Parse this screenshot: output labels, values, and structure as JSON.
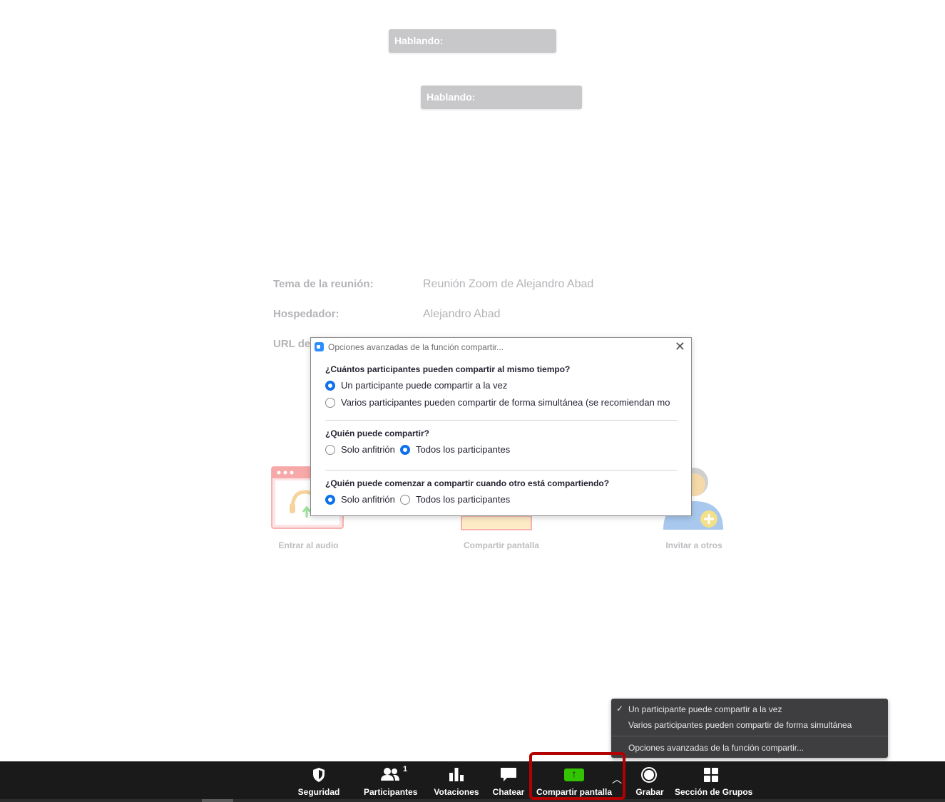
{
  "speaking_labels": [
    "Hablando:",
    "Hablando:"
  ],
  "meeting_info": {
    "topic_label": "Tema de la reunión:",
    "topic_value": "Reunión Zoom de Alejandro Abad",
    "host_label": "Hospedador:",
    "host_value": "Alejandro Abad",
    "url_label": "URL de"
  },
  "tiles": {
    "audio": "Entrar al audio",
    "share": "Compartir pantalla",
    "invite": "Invitar a otros"
  },
  "dialog": {
    "title": "Opciones avanzadas de la función compartir...",
    "q1": "¿Cuántos participantes pueden compartir al mismo tiempo?",
    "q1_opt1": "Un participante puede compartir a la vez",
    "q1_opt2": "Varios participantes pueden compartir de forma simultánea (se recomiendan mo",
    "q1_selected": 1,
    "q2": "¿Quién puede compartir?",
    "q2_opt1": "Solo anfitrión",
    "q2_opt2": "Todos los participantes",
    "q2_selected": 2,
    "q3": "¿Quién puede comenzar a compartir cuando otro está compartiendo?",
    "q3_opt1": "Solo anfitrión",
    "q3_opt2": "Todos los participantes",
    "q3_selected": 1
  },
  "menu": {
    "item1": "Un participante puede compartir a la vez",
    "item2": "Varios participantes pueden compartir de forma simultánea",
    "item3": "Opciones avanzadas de la función compartir...",
    "checked_item": 1
  },
  "toolbar": {
    "security": "Seguridad",
    "participants": "Participantes",
    "participants_count": "1",
    "polls": "Votaciones",
    "chat": "Chatear",
    "share": "Compartir pantalla",
    "record": "Grabar",
    "breakout": "Sección de Grupos"
  },
  "colors": {
    "accent": "#0e71eb",
    "share_green": "#33c300",
    "highlight": "#b30000",
    "toolbar_bg": "#1a1a1a"
  }
}
